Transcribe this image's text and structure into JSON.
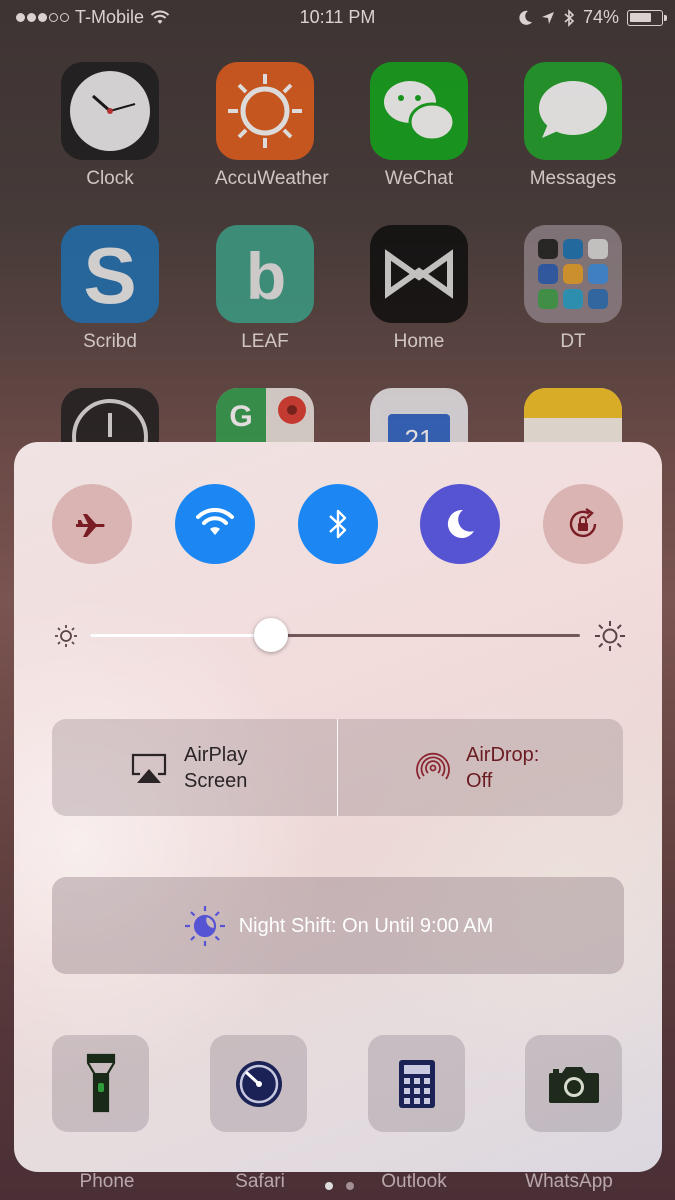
{
  "status_bar": {
    "carrier": "T-Mobile",
    "time": "10:11 PM",
    "battery": "74%",
    "battery_level": 0.74,
    "signal_bars_filled": 3,
    "signal_bars_total": 5
  },
  "home_apps": [
    {
      "label": "Clock"
    },
    {
      "label": "AccuWeather"
    },
    {
      "label": "WeChat"
    },
    {
      "label": "Messages"
    },
    {
      "label": "Scribd"
    },
    {
      "label": "LEAF"
    },
    {
      "label": "Home"
    },
    {
      "label": "DT"
    }
  ],
  "dock": [
    "Phone",
    "Safari",
    "Outlook",
    "WhatsApp"
  ],
  "control_center": {
    "toggles": {
      "airplane_mode": "off",
      "wifi": "on",
      "bluetooth": "on",
      "do_not_disturb": "on",
      "rotation_lock": "off"
    },
    "brightness_level": 0.37,
    "airplay": {
      "line1": "AirPlay",
      "line2": "Screen"
    },
    "airdrop": {
      "line1": "AirDrop:",
      "line2": "Off"
    },
    "night_shift": "Night Shift: On Until 9:00 AM",
    "shortcuts": [
      "flashlight-icon",
      "timer-icon",
      "calculator-icon",
      "camera-icon"
    ]
  },
  "colors": {
    "toggle_on_blue": "#1c87f2",
    "toggle_on_purple": "#5754d4",
    "toggle_off": "#d9b4b2",
    "airplane_icon": "#7a1c24"
  }
}
